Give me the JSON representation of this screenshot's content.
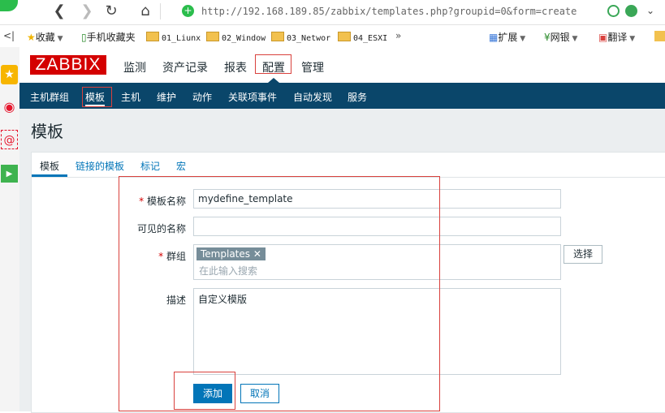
{
  "browser": {
    "url": "http://192.168.189.85/zabbix/templates.php?groupid=0&form=create",
    "bookmarks": {
      "favorites": "收藏",
      "mobile_favorites": "手机收藏夹",
      "folders": [
        "01_Liunx",
        "02_Window",
        "03_Networ",
        "04_ESXI"
      ],
      "more": "»",
      "extensions": "扩展",
      "netbank": "网银",
      "translate": "翻译"
    }
  },
  "zabbix": {
    "logo": "ZABBIX",
    "top_menu": [
      "监测",
      "资产记录",
      "报表",
      "配置",
      "管理"
    ],
    "active_top_menu": "配置",
    "sub_menu": [
      "主机群组",
      "模板",
      "主机",
      "维护",
      "动作",
      "关联项事件",
      "自动发现",
      "服务"
    ],
    "active_sub_menu": "模板",
    "page_title": "模板",
    "tabs": [
      "模板",
      "链接的模板",
      "标记",
      "宏"
    ],
    "active_tab": "模板",
    "form": {
      "template_name_label": "模板名称",
      "template_name_value": "mydefine_template",
      "visible_name_label": "可见的名称",
      "visible_name_value": "",
      "groups_label": "群组",
      "group_tag": "Templates",
      "group_search_placeholder": "在此输入搜索",
      "select_button": "选择",
      "description_label": "描述",
      "description_value": "自定义模版",
      "required_mark": "*",
      "add_button": "添加",
      "cancel_button": "取消"
    }
  },
  "colors": {
    "brand_red": "#d40000",
    "nav_blue": "#0a466a",
    "link_blue": "#0275b8",
    "annotation_red": "#d9413d"
  }
}
